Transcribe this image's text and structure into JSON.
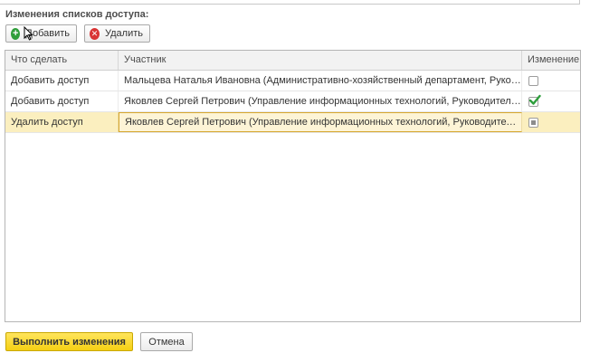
{
  "section": {
    "title": "Изменения списков доступа:"
  },
  "toolbar": {
    "add_label": "Добавить",
    "delete_label": "Удалить"
  },
  "table": {
    "columns": [
      "Что сделать",
      "Участник",
      "Изменение"
    ],
    "rows": [
      {
        "action": "Добавить доступ",
        "member": "Мальцева Наталья Ивановна (Административно-хозяйственный департамент, Руководо...",
        "change": "unchecked"
      },
      {
        "action": "Добавить доступ",
        "member": "Яковлев Сергей Петрович (Управление информационных технологий, Руководитель уп...",
        "change": "checked"
      },
      {
        "action": "Удалить доступ",
        "member": "Яковлев Сергей Петрович (Управление информационных технологий, Руководитель уп...",
        "change": "indeterminate",
        "selected": true
      }
    ]
  },
  "footer": {
    "execute_label": "Выполнить изменения",
    "cancel_label": "Отмена"
  },
  "colors": {
    "accent_yellow": "#f5cf13",
    "selected_row": "#fbefbf",
    "add_icon": "#2f9e3a",
    "delete_icon": "#d93434",
    "checkmark": "#2e9e3c"
  }
}
